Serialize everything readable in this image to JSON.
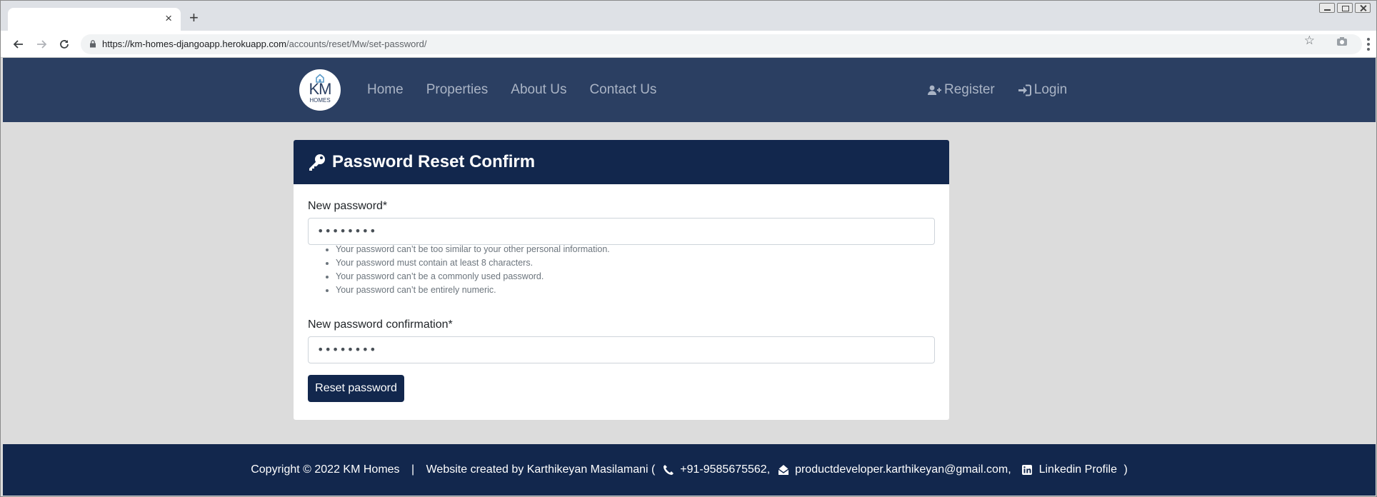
{
  "browser": {
    "url_host": "https://km-homes-djangoapp.herokuapp.com",
    "url_path": "/accounts/reset/Mw/set-password/",
    "tab_close": "×",
    "new_tab": "+"
  },
  "navbar": {
    "logo": {
      "main": "KM",
      "sub": "HOMES"
    },
    "links": [
      "Home",
      "Properties",
      "About Us",
      "Contact Us"
    ],
    "register": "Register",
    "login": "Login"
  },
  "card": {
    "title": "Password Reset Confirm",
    "new_password_label": "New password*",
    "new_password_value": "••••••••",
    "help": [
      "Your password can’t be too similar to your other personal information.",
      "Your password must contain at least 8 characters.",
      "Your password can’t be a commonly used password.",
      "Your password can’t be entirely numeric."
    ],
    "confirm_label": "New password confirmation*",
    "confirm_value": "••••••••",
    "submit": "Reset password"
  },
  "footer": {
    "copyright": "Copyright © 2022 KM Homes",
    "separator": "|",
    "credit": "Website created by Karthikeyan Masilamani (",
    "phone": "+91-9585675562,",
    "email": "productdeveloper.karthikeyan@gmail.com,",
    "linkedin": "Linkedin Profile",
    "close": ")"
  },
  "colors": {
    "navbar": "#2b3f62",
    "primary": "#12274d",
    "page_bg": "#dcdcdc",
    "nav_link": "#aab4c5"
  }
}
